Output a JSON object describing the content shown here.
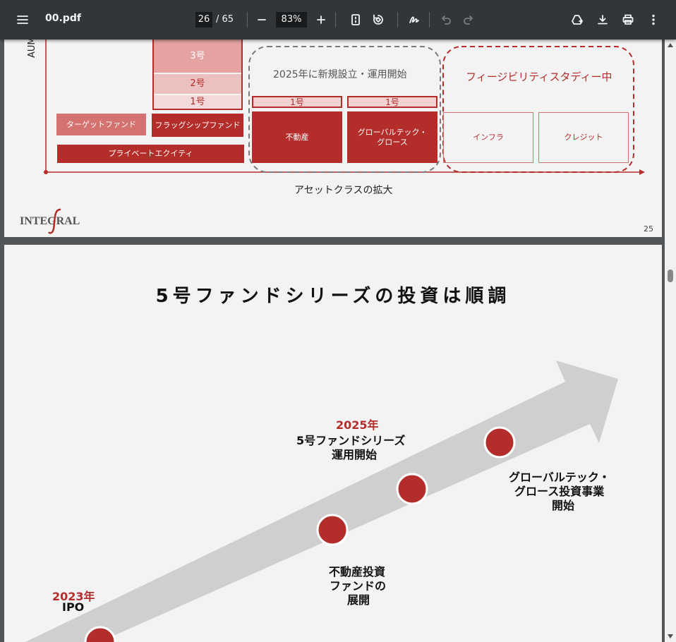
{
  "toolbar": {
    "menu_icon": "menu-icon",
    "filename": "00.pdf",
    "current_page": "26",
    "total_pages": "/ 65",
    "zoom": "83%",
    "icons": [
      "minus-icon",
      "plus-icon",
      "fit-page-icon",
      "rotate-icon",
      "annotate-icon",
      "undo-icon",
      "redo-icon",
      "drive-add-icon",
      "download-icon",
      "print-icon",
      "more-vert-icon"
    ]
  },
  "slide25": {
    "y_axis_label": "AUM",
    "x_axis_label": "アセットクラスの拡大",
    "boxes": {
      "fund3": "3号",
      "fund2": "2号",
      "fund1": "1号",
      "target_fund": "ターゲットファンド",
      "flagship_fund": "フラッグシップファンド",
      "private_equity": "プライベートエクイティ",
      "realestate_fund1": "1号",
      "realestate": "不動産",
      "growth_fund1": "1号",
      "growth": "グローバルテック・\nグロース",
      "launch_2025": "2025年に新規設立・運用開始",
      "feasibility": "フィージビリティスタディー中",
      "infra": "インフラ",
      "credit": "クレジット"
    },
    "logo": "INTEGRAL",
    "page_number": "25",
    "colors": {
      "dark_red": "#b32d2a",
      "mid_red": "#d47270",
      "light_red": "#e4a3a2",
      "pale_red": "#f1d2d1"
    }
  },
  "slide26": {
    "title": "5号ファンドシリーズの投資は順調",
    "milestones": {
      "ipo_year": "2023年",
      "ipo_label": "IPO",
      "fund5_year": "2025年",
      "fund5_label_1": "5号ファンドシリーズ",
      "fund5_label_2": "運用開始",
      "realestate_label_1": "不動産投資",
      "realestate_label_2": "ファンドの",
      "realestate_label_3": "展開",
      "growth_label_1": "グローバルテック・",
      "growth_label_2": "グロース投資事業",
      "growth_label_3": "開始"
    },
    "colors": {
      "arrow": "#cfcfcf",
      "dot": "#b32d2a",
      "year_text": "#b32d2a"
    }
  }
}
